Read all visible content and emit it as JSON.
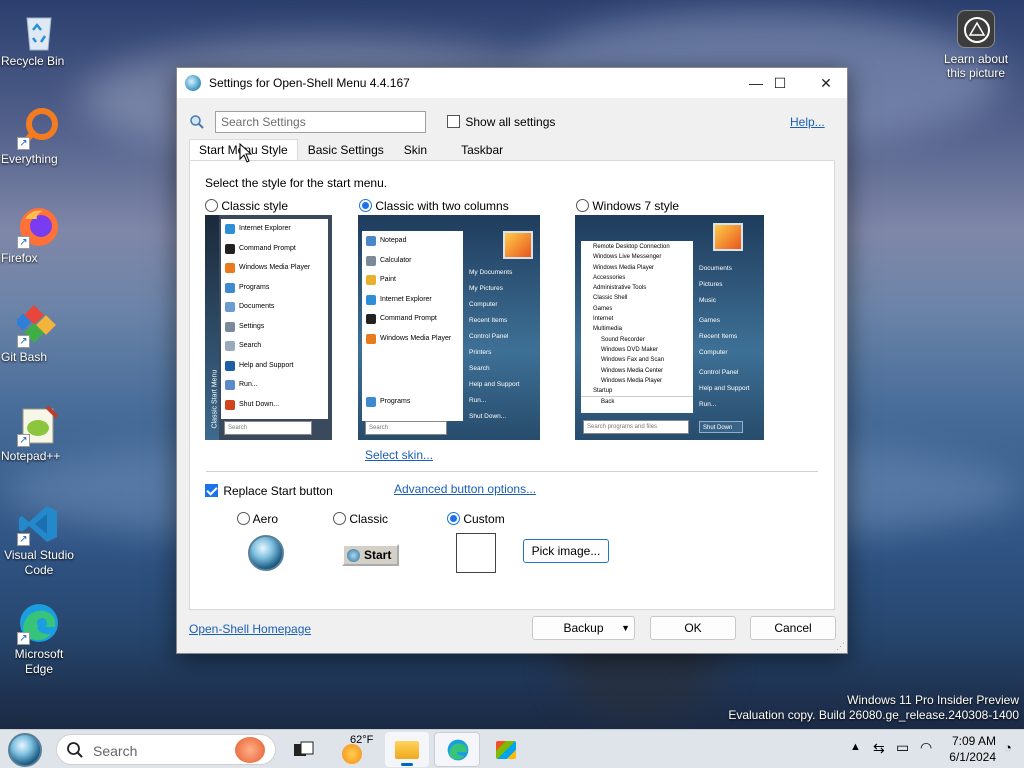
{
  "desktop": {
    "icons": [
      {
        "label": "Recycle Bin",
        "icon": "recycle-bin-icon"
      },
      {
        "label": "Everything",
        "icon": "everything-icon"
      },
      {
        "label": "Firefox",
        "icon": "firefox-icon"
      },
      {
        "label": "Git Bash",
        "icon": "git-bash-icon"
      },
      {
        "label": "Notepad++",
        "icon": "notepadpp-icon"
      },
      {
        "label": "Visual Studio Code",
        "icon": "vscode-icon"
      },
      {
        "label": "Microsoft Edge",
        "icon": "edge-icon"
      }
    ],
    "learn_label": "Learn about this picture",
    "watermark_line1": "Windows 11 Pro Insider Preview",
    "watermark_line2": "Evaluation copy. Build 26080.ge_release.240308-1400"
  },
  "window": {
    "title": "Settings for Open-Shell Menu 4.4.167",
    "search_placeholder": "Search Settings",
    "show_all_label": "Show all settings",
    "show_all_checked": false,
    "help_label": "Help...",
    "tabs": [
      {
        "label": "Start Menu Style",
        "active": true
      },
      {
        "label": "Basic Settings",
        "active": false
      },
      {
        "label": "Skin",
        "active": false
      },
      {
        "label": "Taskbar",
        "active": false
      }
    ],
    "instruction": "Select the style for the start menu.",
    "styles": [
      {
        "label": "Classic style",
        "selected": false
      },
      {
        "label": "Classic with two columns",
        "selected": true
      },
      {
        "label": "Windows 7 style",
        "selected": false
      }
    ],
    "select_skin_label": "Select skin...",
    "replace_start_label": "Replace Start button",
    "replace_start_checked": true,
    "advanced_button_label": "Advanced button options...",
    "button_styles": [
      {
        "label": "Aero",
        "selected": false
      },
      {
        "label": "Classic",
        "selected": false
      },
      {
        "label": "Custom",
        "selected": true
      }
    ],
    "classic_start_label": "Start",
    "pick_image_label": "Pick image...",
    "homepage_label": "Open-Shell Homepage",
    "backup_label": "Backup",
    "ok_label": "OK",
    "cancel_label": "Cancel",
    "preview_classic": {
      "items": [
        "Internet Explorer",
        "Command Prompt",
        "Windows Media Player",
        "Programs",
        "Documents",
        "Settings",
        "Search",
        "Help and Support",
        "Run...",
        "Shut Down..."
      ],
      "sidebar": "Classic Start Menu",
      "search": "Search"
    },
    "preview_two_col": {
      "left": [
        "Notepad",
        "Calculator",
        "Paint",
        "Internet Explorer",
        "Command Prompt",
        "Windows Media Player"
      ],
      "right": [
        "My Documents",
        "My Pictures",
        "Computer",
        "Recent Items",
        "Control Panel",
        "Printers",
        "Search",
        "Help and Support",
        "Run...",
        "Shut Down..."
      ],
      "programs": "Programs",
      "search": "Search"
    },
    "preview_win7": {
      "left": [
        "Remote Desktop Connection",
        "Windows Live Messenger",
        "Windows Media Player",
        "Accessories",
        "Administrative Tools",
        "Classic Shell",
        "Games",
        "Internet",
        "Multimedia",
        "Sound Recorder",
        "Windows DVD Maker",
        "Windows Fax and Scan",
        "Windows Media Center",
        "Windows Media Player",
        "Startup",
        "Back"
      ],
      "right": [
        "Documents",
        "Pictures",
        "Music",
        "Games",
        "Recent Items",
        "Computer",
        "Control Panel",
        "Help and Support",
        "Run..."
      ],
      "search": "Search programs and files",
      "shutdown": "Shut Down"
    }
  },
  "taskbar": {
    "search_placeholder": "Search",
    "weather": "62°F",
    "time": "7:09 AM",
    "date": "6/1/2024"
  }
}
